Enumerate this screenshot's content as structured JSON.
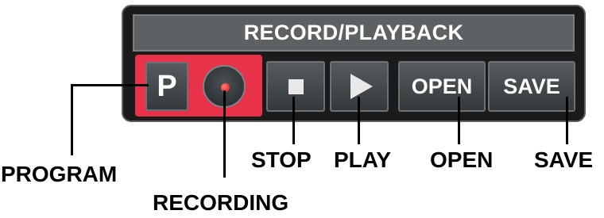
{
  "panel": {
    "title": "RECORD/PLAYBACK",
    "program_button": "P",
    "open_button": "OPEN",
    "save_button": "SAVE"
  },
  "callouts": {
    "program": "PROGRAM",
    "recording": "RECORDING",
    "stop": "STOP",
    "play": "PLAY",
    "open": "OPEN",
    "save": "SAVE"
  },
  "colors": {
    "panel_bg": "#1b1b1b",
    "title_bar": "#5d6163",
    "record_group": "#e8324a",
    "record_dot": "#e01515",
    "button_face": "#45494c"
  },
  "icons": {
    "record": "record-icon",
    "stop": "stop-icon",
    "play": "play-icon"
  }
}
